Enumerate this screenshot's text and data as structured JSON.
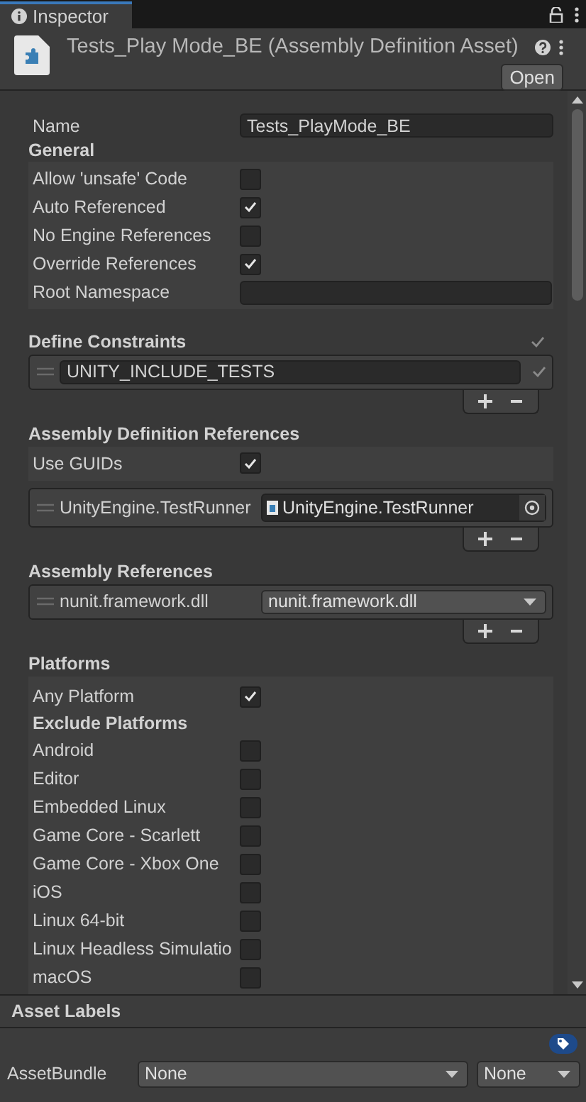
{
  "tab": {
    "title": "Inspector",
    "selected": true
  },
  "header": {
    "title": "Tests_Play Mode_BE (Assembly Definition Asset)",
    "open_button": "Open"
  },
  "name_field": {
    "label": "Name",
    "value": "Tests_PlayMode_BE"
  },
  "general": {
    "title": "General",
    "rows": [
      {
        "kind": "checkbox",
        "label": "Allow 'unsafe' Code",
        "checked": false
      },
      {
        "kind": "checkbox",
        "label": "Auto Referenced",
        "checked": true
      },
      {
        "kind": "checkbox",
        "label": "No Engine References",
        "checked": false
      },
      {
        "kind": "checkbox",
        "label": "Override References",
        "checked": true
      },
      {
        "kind": "text",
        "label": "Root Namespace"
      }
    ]
  },
  "define_constraints": {
    "title": "Define Constraints",
    "items": [
      {
        "value": "UNITY_INCLUDE_TESTS"
      }
    ]
  },
  "assembly_definition_references": {
    "title": "Assembly Definition References",
    "use_guids": {
      "label": "Use GUIDs",
      "checked": true
    },
    "items": [
      {
        "label": "UnityEngine.TestRunner",
        "value": "UnityEngine.TestRunner"
      }
    ]
  },
  "assembly_references": {
    "title": "Assembly References",
    "items": [
      {
        "label": "nunit.framework.dll",
        "value": "nunit.framework.dll"
      }
    ]
  },
  "platforms": {
    "title": "Platforms",
    "any_platform": {
      "label": "Any Platform",
      "checked": true
    },
    "exclude_title": "Exclude Platforms",
    "items": [
      {
        "label": "Android",
        "checked": false
      },
      {
        "label": "Editor",
        "checked": false
      },
      {
        "label": "Embedded Linux",
        "checked": false
      },
      {
        "label": "Game Core - Scarlett",
        "checked": false
      },
      {
        "label": "Game Core - Xbox One",
        "checked": false
      },
      {
        "label": "iOS",
        "checked": false
      },
      {
        "label": "Linux 64-bit",
        "checked": false
      },
      {
        "label": "Linux Headless Simulatio",
        "checked": false
      },
      {
        "label": "macOS",
        "checked": false
      }
    ]
  },
  "asset_labels": {
    "title": "Asset Labels",
    "bundle_label": "AssetBundle",
    "bundle": "None",
    "variant": "None"
  }
}
